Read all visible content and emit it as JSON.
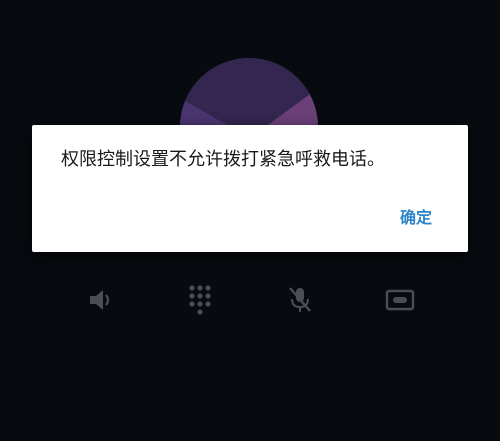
{
  "dialog": {
    "message": "权限控制设置不允许拨打紧急呼救电话。",
    "ok_label": "确定"
  },
  "call_actions": [
    {
      "name": "speaker",
      "icon": "speaker-icon"
    },
    {
      "name": "dialpad",
      "icon": "dialpad-icon"
    },
    {
      "name": "mute",
      "icon": "microphone-off-icon"
    },
    {
      "name": "record",
      "icon": "record-icon"
    }
  ],
  "colors": {
    "background": "#070a0f",
    "dialog_background": "#ffffff",
    "message_text": "#1a1a1a",
    "accent": "#2f86c9",
    "icon_dimmed": "#4a4d52",
    "avatar_primary": "#3a2a5c",
    "avatar_secondary": "#5a3a6e"
  }
}
